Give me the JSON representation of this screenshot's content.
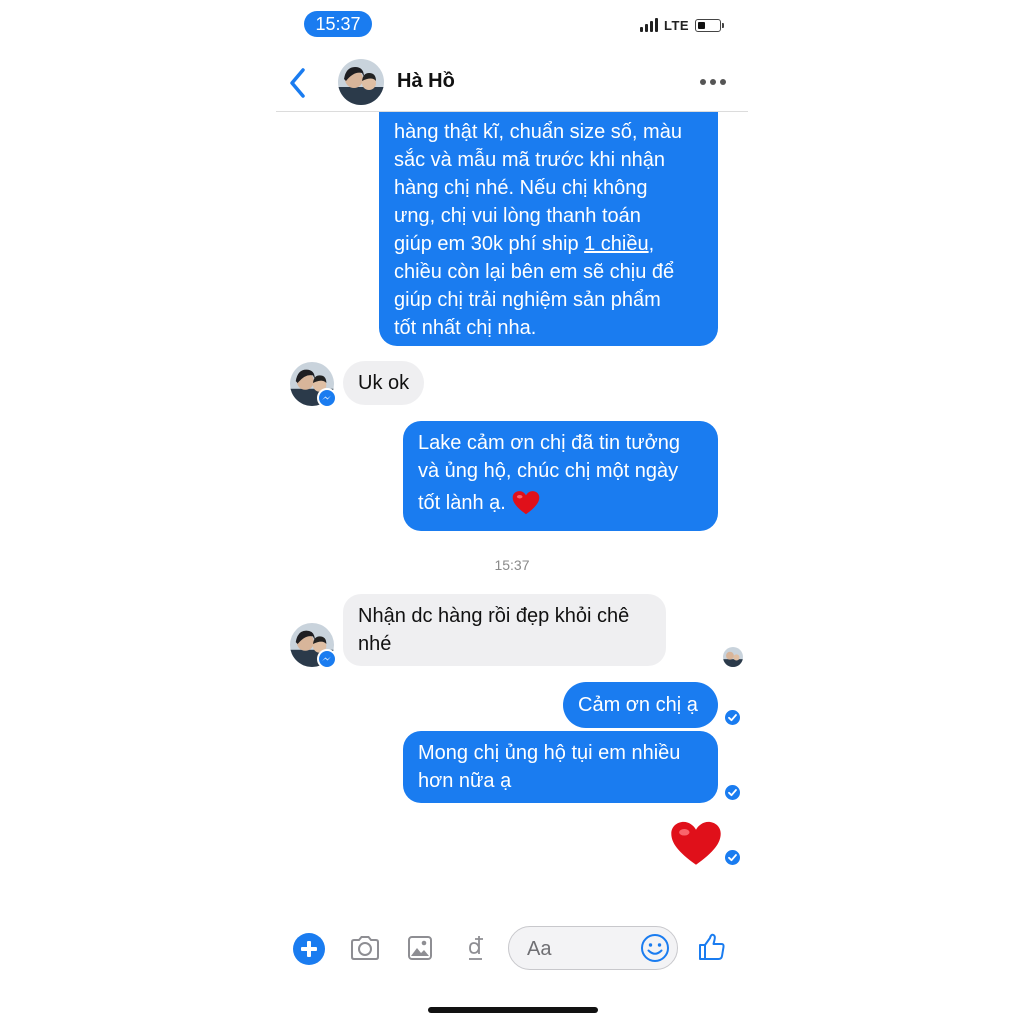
{
  "status_bar": {
    "time": "15:37",
    "network": "LTE"
  },
  "header": {
    "contact_name": "Hà Hồ"
  },
  "messages": {
    "out_1_lines": [
      "hàng thật kĩ, chuẩn size số, màu",
      "sắc và mẫu mã trước khi nhận",
      "hàng chị nhé. Nếu chị không",
      "ưng, chị vui lòng thanh toán",
      "chiều còn lại bên em sẽ chịu để",
      "giúp chị trải nghiệm sản phẩm",
      "tốt nhất chị nha."
    ],
    "out_1_line5_prefix": "giúp em 30k phí ship ",
    "out_1_line5_underlined": "1 chiều",
    "out_1_line5_suffix": ",",
    "in_1": "Uk ok",
    "out_2_lines": [
      "Lake  cảm ơn chị đã tin tưởng",
      "và ủng hộ, chúc chị một ngày",
      "tốt lành ạ."
    ],
    "out_2_emoji": "heart",
    "timestamp": "15:37",
    "in_2_lines": [
      "Nhận dc hàng rồi đẹp khỏi chê",
      "nhé"
    ],
    "out_3": "Cảm ơn chị ạ",
    "out_4_lines": [
      "Mong chị ủng hộ tụi em nhiều",
      "hơn nữa ạ"
    ],
    "out_5_emoji": "heart"
  },
  "composer": {
    "placeholder": "Aa"
  },
  "icons": [
    "back-chevron-icon",
    "more-icon",
    "plus-icon",
    "camera-icon",
    "image-icon",
    "dong-payment-icon",
    "emoji-icon",
    "like-icon",
    "heart-icon",
    "messenger-badge-icon",
    "seen-check-icon"
  ],
  "colors": {
    "accent": "#1a7cf0",
    "incoming_bubble": "#efeff1",
    "heart": "#e0101a"
  }
}
